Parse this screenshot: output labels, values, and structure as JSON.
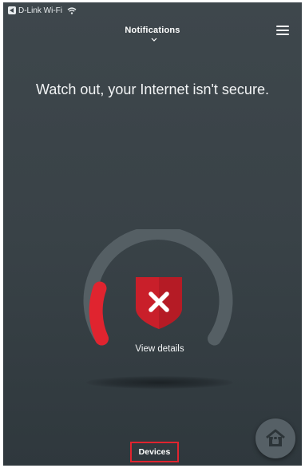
{
  "status_bar": {
    "network_name": "D-Link Wi-Fi",
    "icons": [
      "back-to-app-icon",
      "wifi-icon"
    ]
  },
  "header": {
    "title": "Notifications",
    "icons": [
      "chevron-down-icon",
      "hamburger-menu-icon"
    ]
  },
  "main": {
    "headline": "Watch out, your Internet isn't secure.",
    "security_status": "insecure",
    "gauge": {
      "status_color": "#e0242f",
      "track_color": "#555f64"
    },
    "shield_icon": "shield-x-icon",
    "view_details_label": "View details"
  },
  "footer": {
    "devices_label": "Devices",
    "home_lock_icon": "home-lock-icon"
  },
  "colors": {
    "background": "#3b4449",
    "accent_red": "#e0242f",
    "text": "#ffffff"
  }
}
